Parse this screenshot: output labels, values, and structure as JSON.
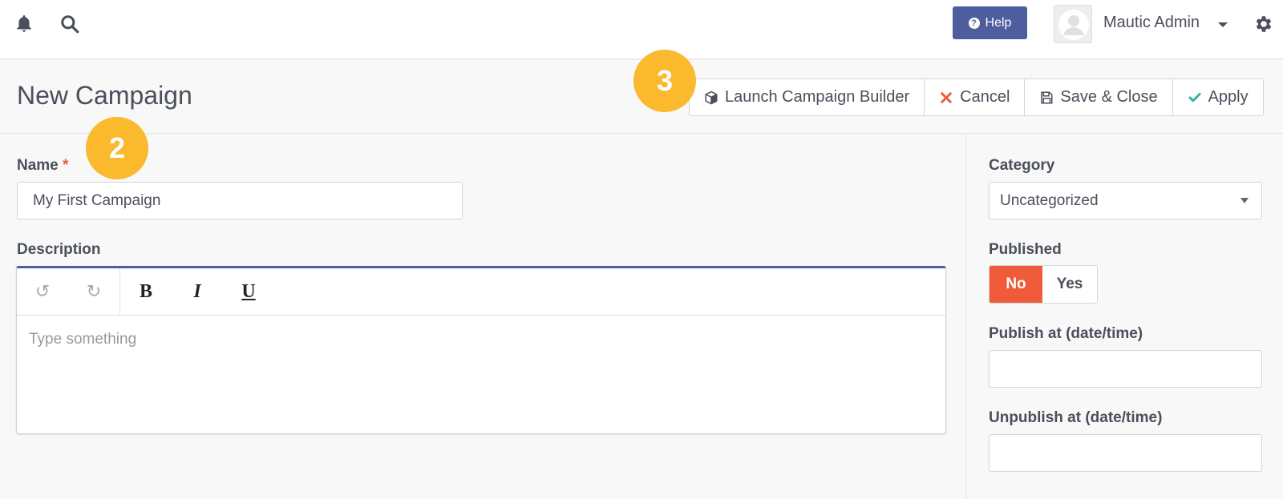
{
  "topbar": {
    "icons": [
      "bell-icon",
      "search-icon",
      "gear-icon"
    ],
    "help_label": "Help",
    "user_name": "Mautic Admin"
  },
  "header": {
    "title": "New Campaign",
    "buttons": {
      "launch": "Launch Campaign Builder",
      "cancel": "Cancel",
      "save_close": "Save & Close",
      "apply": "Apply"
    }
  },
  "callouts": {
    "one": "2",
    "two": "3"
  },
  "form": {
    "name_label": "Name",
    "required_mark": "*",
    "name_value": "My First Campaign",
    "description_label": "Description",
    "editor_buttons": {
      "bold": "B",
      "italic": "I",
      "underline": "U"
    },
    "description_placeholder": "Type something"
  },
  "sidebar": {
    "category_label": "Category",
    "category_value": "Uncategorized",
    "published_label": "Published",
    "published_no": "No",
    "published_yes": "Yes",
    "published_value": "No",
    "publish_at_label": "Publish at (date/time)",
    "publish_at_value": "",
    "unpublish_at_label": "Unpublish at (date/time)",
    "unpublish_at_value": ""
  },
  "colors": {
    "primary": "#4e5d9d",
    "danger": "#f05c3a",
    "success": "#2fb39a",
    "callout": "#fbb92d"
  }
}
